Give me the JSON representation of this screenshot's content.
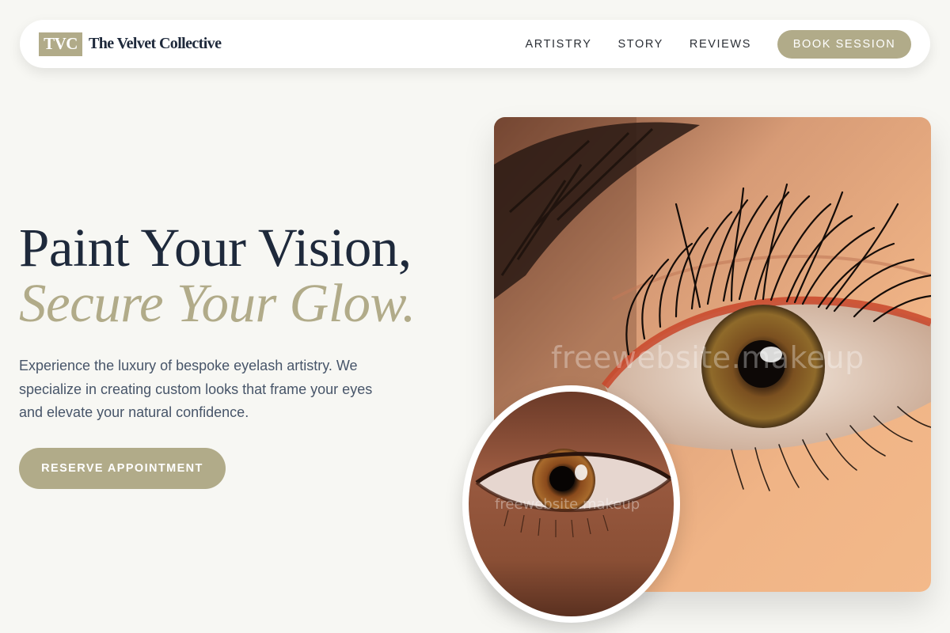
{
  "brand": {
    "mark": "TVC",
    "name": "The Velvet Collective"
  },
  "nav": {
    "links": [
      "ARTISTRY",
      "STORY",
      "REVIEWS"
    ],
    "cta": "BOOK SESSION"
  },
  "hero": {
    "title_line1": "Paint Your Vision,",
    "title_line2": "Secure Your Glow.",
    "description": "Experience the luxury of bespoke eyelash artistry. We specialize in creating custom looks that frame your eyes and elevate your natural confidence.",
    "cta": "RESERVE APPOINTMENT"
  },
  "images": {
    "main_watermark": "freewebsite.makeup",
    "inset_watermark": "freewebsite.makeup",
    "main_alt": "close-up eye with long lashes",
    "inset_alt": "close-up brown eye"
  },
  "colors": {
    "background": "#f7f7f3",
    "accent": "#b1ab89",
    "heading": "#1e293b",
    "body_text": "#475569"
  }
}
